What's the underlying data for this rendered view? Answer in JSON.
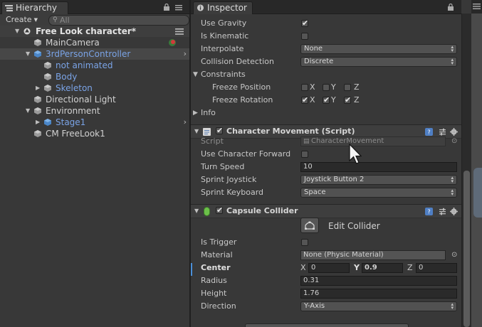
{
  "hierarchy": {
    "tab_label": "Hierarchy",
    "create_label": "Create",
    "search_placeholder": "All",
    "items": [
      {
        "label": "Free Look character*",
        "depth": 0
      },
      {
        "label": "MainCamera",
        "depth": 1
      },
      {
        "label": "3rdPersonController",
        "depth": 1
      },
      {
        "label": "not animated",
        "depth": 2
      },
      {
        "label": "Body",
        "depth": 2
      },
      {
        "label": "Skeleton",
        "depth": 2
      },
      {
        "label": "Directional Light",
        "depth": 1
      },
      {
        "label": "Environment",
        "depth": 1
      },
      {
        "label": "Stage1",
        "depth": 2
      },
      {
        "label": "CM FreeLook1",
        "depth": 1
      }
    ]
  },
  "inspector": {
    "tab_label": "Inspector",
    "rigidbody": {
      "use_gravity": "Use Gravity",
      "use_gravity_value": true,
      "is_kinematic": "Is Kinematic",
      "is_kinematic_value": false,
      "interpolate": "Interpolate",
      "interpolate_value": "None",
      "collision_detection": "Collision Detection",
      "collision_detection_value": "Discrete",
      "constraints": "Constraints",
      "freeze_position": "Freeze Position",
      "freeze_rotation": "Freeze Rotation",
      "axes": [
        "X",
        "Y",
        "Z"
      ],
      "freeze_position_values": [
        false,
        false,
        false
      ],
      "freeze_rotation_values": [
        true,
        true,
        true
      ],
      "info": "Info"
    },
    "character_movement": {
      "title": "Character Movement (Script)",
      "enabled": true,
      "script_label": "Script",
      "script_value": "CharacterMovement",
      "use_character_forward": "Use Character Forward",
      "use_character_forward_value": false,
      "turn_speed": "Turn Speed",
      "turn_speed_value": "10",
      "sprint_joystick": "Sprint Joystick",
      "sprint_joystick_value": "Joystick Button 2",
      "sprint_keyboard": "Sprint Keyboard",
      "sprint_keyboard_value": "Space"
    },
    "capsule_collider": {
      "title": "Capsule Collider",
      "enabled": true,
      "edit_collider": "Edit Collider",
      "is_trigger": "Is Trigger",
      "is_trigger_value": false,
      "material": "Material",
      "material_value": "None (Physic Material)",
      "center": "Center",
      "center_x_label": "X",
      "center_x": "0",
      "center_y_label": "Y",
      "center_y": "0.9",
      "center_z_label": "Z",
      "center_z": "0",
      "radius": "Radius",
      "radius_value": "0.31",
      "height": "Height",
      "height_value": "1.76",
      "direction": "Direction",
      "direction_value": "Y-Axis"
    }
  },
  "colors": {
    "panel_bg": "#383838",
    "selection": "#474747",
    "blue_text": "#7aa3e6",
    "accent": "#4a8fd8"
  }
}
